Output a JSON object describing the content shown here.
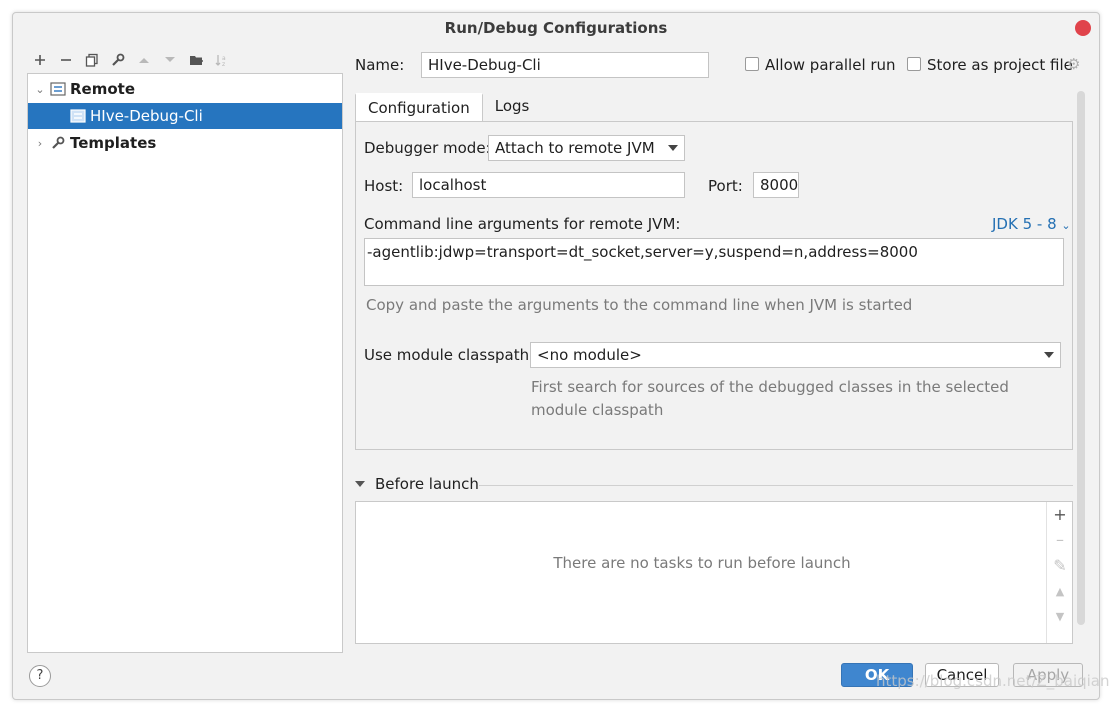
{
  "window": {
    "title": "Run/Debug Configurations"
  },
  "toolbar": {
    "icons": [
      "add-icon",
      "remove-icon",
      "copy-icon",
      "wrench-icon",
      "move-up-icon",
      "move-down-icon",
      "folder-icon",
      "sort-icon"
    ]
  },
  "tree": {
    "items": [
      {
        "label": "Remote",
        "expanded": true,
        "bold": true
      },
      {
        "label": "HIve-Debug-Cli",
        "selected": true
      },
      {
        "label": "Templates",
        "expanded": false,
        "bold": true
      }
    ]
  },
  "form": {
    "name_label": "Name:",
    "name_value": "HIve-Debug-Cli",
    "allow_parallel_label": "Allow parallel run",
    "store_project_label": "Store as project file"
  },
  "tabs": [
    {
      "label": "Configuration",
      "active": true
    },
    {
      "label": "Logs",
      "active": false
    }
  ],
  "config": {
    "debugger_mode_label": "Debugger mode:",
    "debugger_mode_value": "Attach to remote JVM",
    "host_label": "Host:",
    "host_value": "localhost",
    "port_label": "Port:",
    "port_value": "8000",
    "cmd_label": "Command line arguments for remote JVM:",
    "jdk_link": "JDK 5 - 8",
    "cmd_value": "-agentlib:jdwp=transport=dt_socket,server=y,suspend=n,address=8000",
    "cmd_hint": "Copy and paste the arguments to the command line when JVM is started",
    "module_label": "Use module classpath:",
    "module_value": "<no module>",
    "module_hint_line1": "First search for sources of the debugged classes in the selected",
    "module_hint_line2": "module classpath"
  },
  "before_launch": {
    "title": "Before launch",
    "empty_text": "There are no tasks to run before launch"
  },
  "buttons": {
    "help": "?",
    "ok": "OK",
    "cancel": "Cancel",
    "apply": "Apply"
  },
  "watermark": "https://blog.csdn.net/Z_baiqian",
  "colors": {
    "selection": "#2675bf",
    "primary_button": "#3f86cf",
    "link": "#2470b3",
    "close": "#e0434b"
  }
}
